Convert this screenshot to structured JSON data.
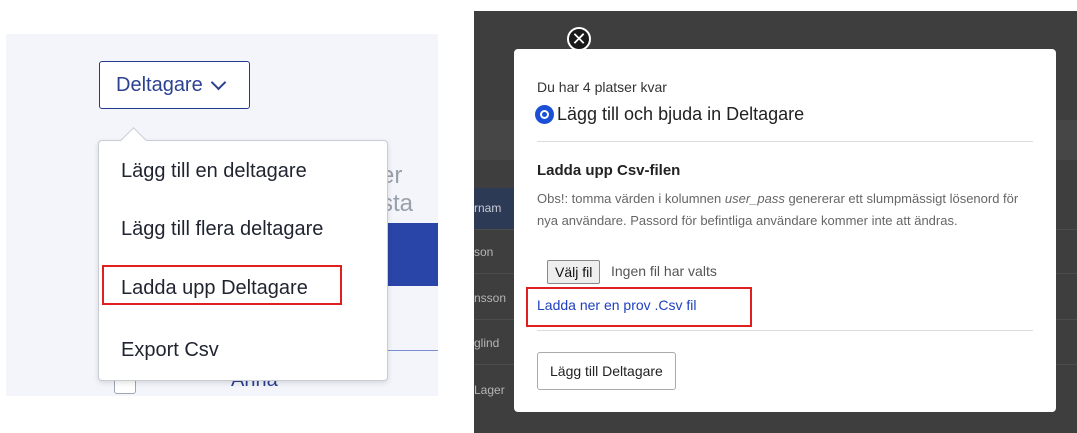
{
  "left": {
    "toggle_label": "Deltagare",
    "background": {
      "ghost_text": "er sta",
      "name_text": "Anna"
    },
    "menu_items": [
      "Lägg till en deltagare",
      "Lägg till flera deltagare",
      "Ladda upp Deltagare",
      "Export Csv"
    ],
    "highlighted_item": "Ladda upp Deltagare"
  },
  "right": {
    "background_rows": [
      "rnam",
      "son",
      "nsson",
      "glind",
      "Lager"
    ],
    "modal": {
      "seats_text": "Du har 4 platser kvar",
      "radio_label": "Lägg till och bjuda in Deltagare",
      "section_title": "Ladda upp Csv-filen",
      "note_prefix": "Obs!: tomma värden i kolumnen ",
      "note_field": "user_pass",
      "note_suffix": " genererar ett slumpmässigt lösenord för nya användare. Passord för befintliga användare kommer inte att ändras.",
      "file_button": "Välj fil",
      "file_status": "Ingen fil har valts",
      "sample_link": "Ladda ner en prov .Csv fil",
      "submit_button": "Lägg till Deltagare",
      "close_glyph": "✕"
    }
  },
  "colors": {
    "brand_blue": "#2c4290",
    "highlight_red": "#e02020",
    "link_blue": "#1d3fbf",
    "overlay": "#3e3e3e"
  },
  "icons": {
    "toggle_chevron": "chevron-down-icon",
    "close": "close-circle-icon"
  }
}
